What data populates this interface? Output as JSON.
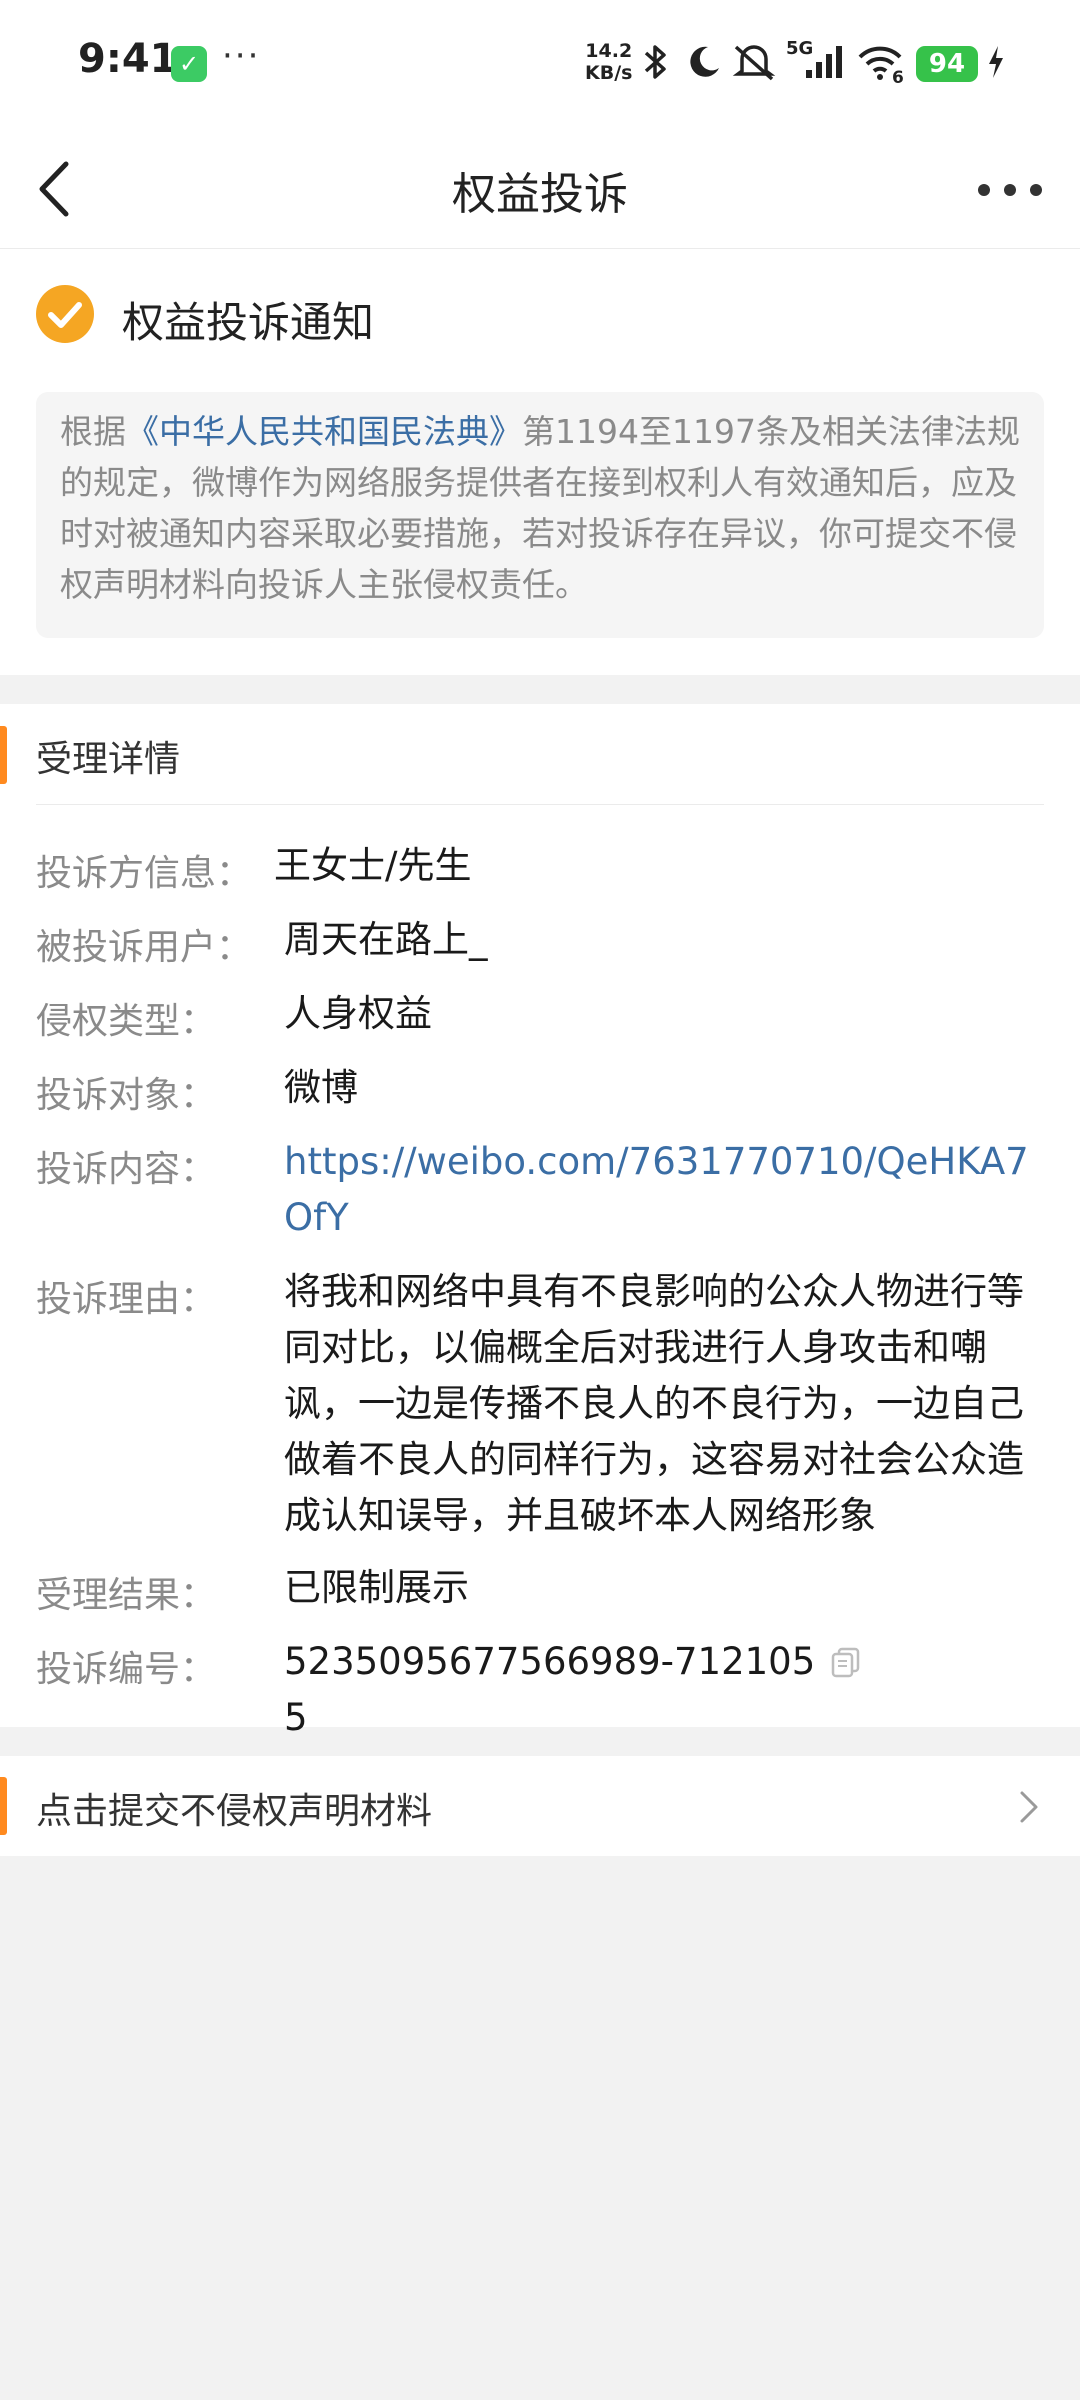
{
  "status_bar": {
    "time": "9:41",
    "app_icon": "shield-check-icon",
    "overflow": "···",
    "net_speed_value": "14.2",
    "net_speed_unit": "KB/s",
    "network": "5G",
    "wifi_level": "6",
    "battery_level": "94",
    "icons": [
      "bluetooth-icon",
      "moon-icon",
      "mute-icon",
      "signal-icon",
      "wifi-icon",
      "charging-icon"
    ]
  },
  "nav": {
    "title": "权益投诉",
    "back_icon": "chevron-left-icon",
    "more_icon": "more-horizontal-icon"
  },
  "notice": {
    "title": "权益投诉通知",
    "text_prefix": "根据",
    "law_link": "《中华人民共和国民法典》",
    "text_suffix": "第1194至1197条及相关法律法规的规定，微博作为网络服务提供者在接到权利人有效通知后，应及时对被通知内容采取必要措施，若对投诉存在异议，你可提交不侵权声明材料向投诉人主张侵权责任。"
  },
  "details": {
    "section_title": "受理详情",
    "rows": [
      {
        "label": "投诉方信息：",
        "value": "王女士/先生"
      },
      {
        "label": "被投诉用户：",
        "value": "周天在路上_"
      },
      {
        "label": "侵权类型：",
        "value": "人身权益"
      },
      {
        "label": "投诉对象：",
        "value": "微博"
      },
      {
        "label": "投诉内容：",
        "value": "https://weibo.com/7631770710/QeHKA7OfY"
      },
      {
        "label": "投诉理由：",
        "value": "将我和网络中具有不良影响的公众人物进行等同对比，以偏概全后对我进行人身攻击和嘲讽，一边是传播不良人的不良行为，一边自己做着不良人的同样行为，这容易对社会公众造成认知误导，并且破坏本人网络形象"
      },
      {
        "label": "受理结果：",
        "value": "已限制展示"
      },
      {
        "label": "投诉编号：",
        "value": "5235095677566989-7121055"
      }
    ]
  },
  "action": {
    "label": "点击提交不侵权声明材料"
  },
  "colors": {
    "accent": "#ff8a1f",
    "link": "#3b6ea5",
    "check_badge": "#f5a623",
    "battery": "#36c24a"
  }
}
